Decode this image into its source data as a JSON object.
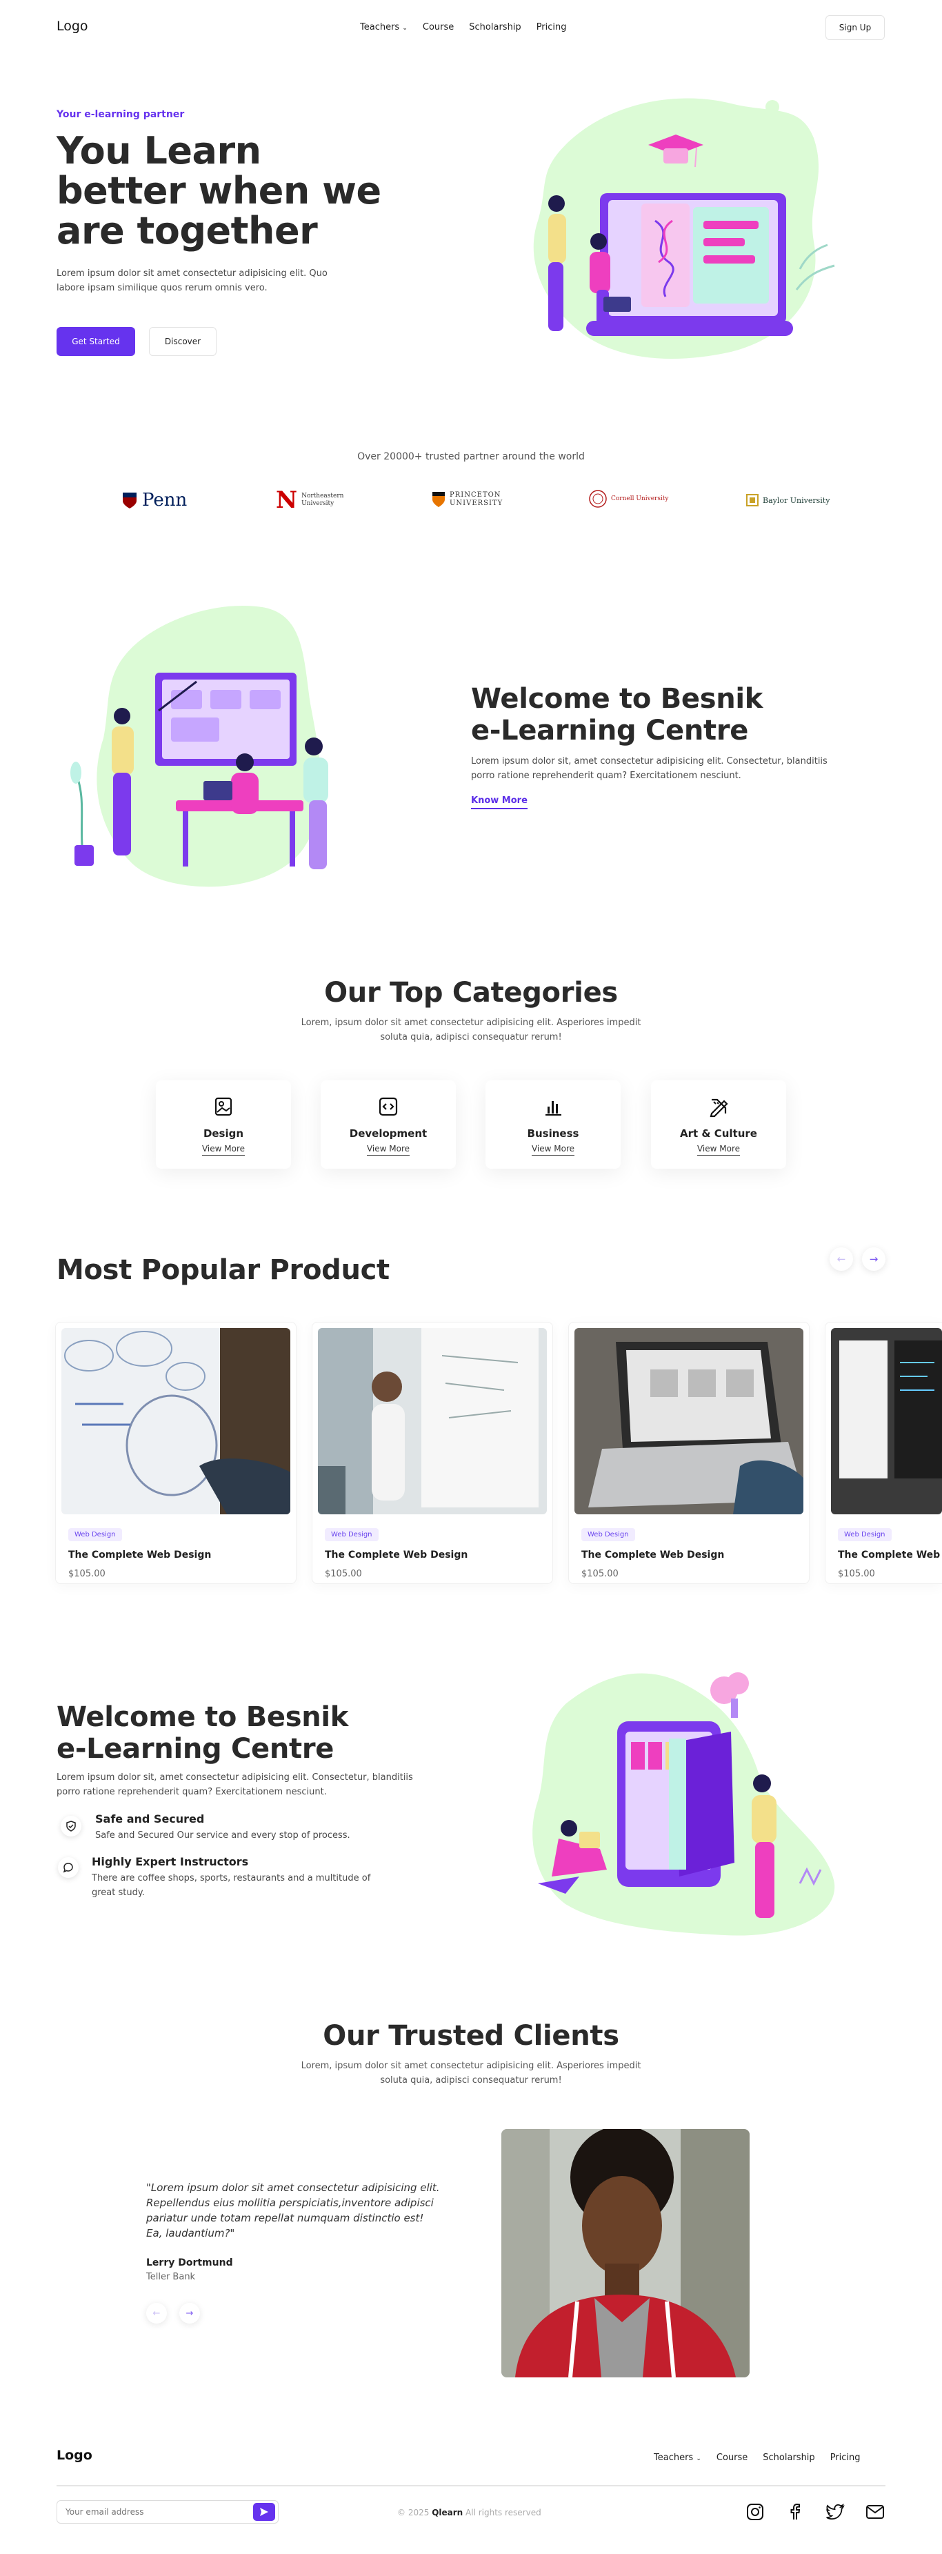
{
  "nav": {
    "logo": "Logo",
    "menu": [
      "Teachers",
      "Course",
      "Scholarship",
      "Pricing"
    ],
    "signup": "Sign Up"
  },
  "hero": {
    "eyebrow": "Your e-learning partner",
    "title_lines": [
      "You Learn",
      "better when we",
      "are together"
    ],
    "desc": "Lorem ipsum dolor sit amet consectetur adipisicing elit. Quo labore ipsam similique quos rerum omnis vero.",
    "primary_btn": "Get Started",
    "secondary_btn": "Discover"
  },
  "partners": {
    "title": "Over 20000+ trusted partner around the world",
    "logos": [
      "Penn",
      "Northeastern University",
      "PRINCETON UNIVERSITY",
      "Cornell University",
      "Baylor University"
    ]
  },
  "welcome": {
    "title_lines": [
      "Welcome to Besnik",
      "e-Learning Centre"
    ],
    "desc": "Lorem ipsum dolor sit, amet consectetur adipisicing elit. Consectetur, blanditiis porro ratione reprehenderit quam? Exercitationem nesciunt.",
    "link": "Know More"
  },
  "categories": {
    "title": "Our Top Categories",
    "desc": "Lorem, ipsum dolor sit amet consectetur adipisicing elit. Asperiores impedit soluta quia, adipisci consequatur rerum!",
    "items": [
      {
        "name": "Design",
        "link": "View More",
        "icon": "image-icon"
      },
      {
        "name": "Development",
        "link": "View More",
        "icon": "code-icon"
      },
      {
        "name": "Business",
        "link": "View More",
        "icon": "bar-chart-icon"
      },
      {
        "name": "Art & Culture",
        "link": "View More",
        "icon": "pen-ruler-icon"
      }
    ]
  },
  "products": {
    "title": "Most Popular Product",
    "items": [
      {
        "tag": "Web Design",
        "title": "The Complete Web Design",
        "price": "$105.00"
      },
      {
        "tag": "Web Design",
        "title": "The Complete Web Design",
        "price": "$105.00"
      },
      {
        "tag": "Web Design",
        "title": "The Complete Web Design",
        "price": "$105.00"
      },
      {
        "tag": "Web Design",
        "title": "The Complete Web Design",
        "price": "$105.00"
      }
    ]
  },
  "features": {
    "title_lines": [
      "Welcome to Besnik",
      "e-Learning Centre"
    ],
    "desc": "Lorem ipsum dolor sit, amet consectetur adipisicing elit. Consectetur, blanditiis porro ratione reprehenderit quam? Exercitationem nesciunt.",
    "items": [
      {
        "title": "Safe and Secured",
        "desc": "Safe and Secured Our service and every stop of process."
      },
      {
        "title": "Highly Expert Instructors",
        "desc": "There are coffee shops, sports, restaurants and a multitude of great study."
      }
    ]
  },
  "clients": {
    "title": "Our Trusted Clients",
    "desc": "Lorem, ipsum dolor sit amet consectetur adipisicing elit. Asperiores impedit soluta quia, adipisci consequatur rerum!",
    "quote": "\"Lorem ipsum dolor sit amet consectetur adipisicing elit. Repellendus eius mollitia perspiciatis,inventore adipisci pariatur unde totam repellat numquam distinctio est! Ea, laudantium?\"",
    "name": "Lerry Dortmund",
    "role": "Teller Bank"
  },
  "footer": {
    "logo": "Logo",
    "menu": [
      "Teachers",
      "Course",
      "Scholarship",
      "Pricing"
    ],
    "email_placeholder": "Your email address",
    "copyright_prefix": "© 2025",
    "copyright_brand": "Qlearn",
    "copyright_suffix": "All rights reserved"
  },
  "colors": {
    "accent": "#6633ee",
    "mint": "#dcfbd6",
    "pink": "#ee3fbf"
  }
}
